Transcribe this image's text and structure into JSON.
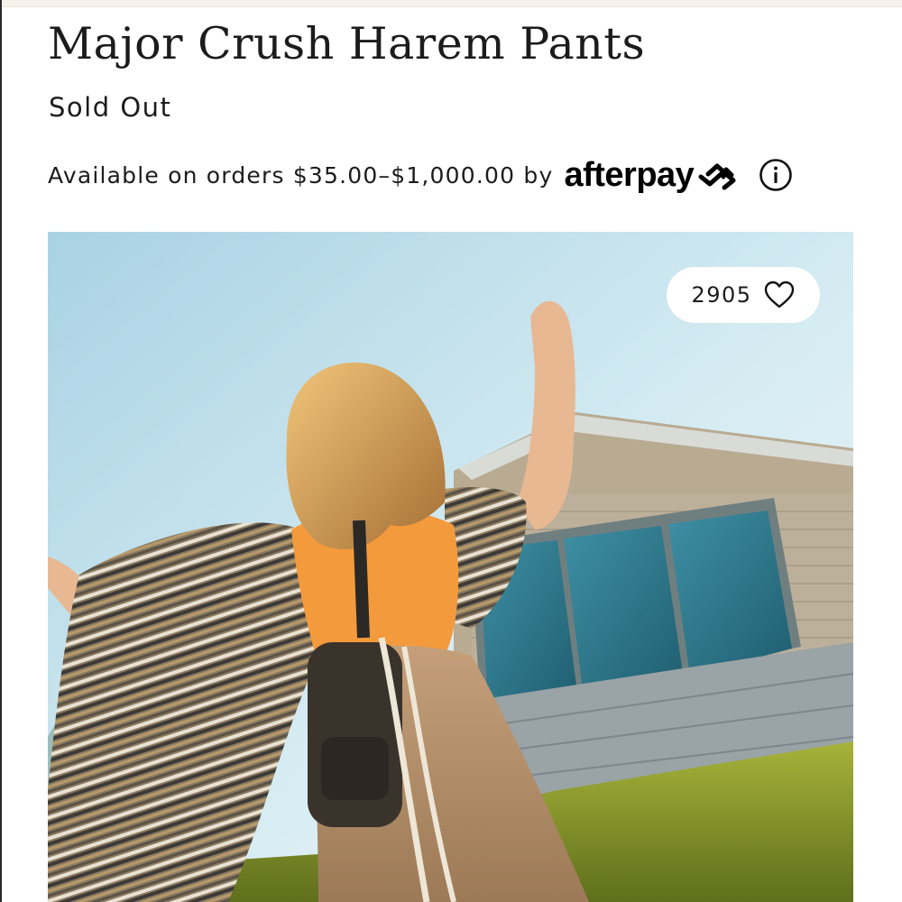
{
  "product": {
    "title": "Major Crush Harem Pants",
    "status": "Sold Out"
  },
  "afterpay": {
    "text": "Available on orders $35.00–$1,000.00 by",
    "logo_text": "afterpay",
    "logo_icon": "afterpay-arrows-icon",
    "info_icon": "info-circle-icon"
  },
  "hero_image": {
    "subject": "product-photo",
    "likes": {
      "count": "2905",
      "icon": "heart-outline-icon"
    }
  },
  "colors": {
    "accent_orange": "#f39a3d",
    "sky": "#b9dcec",
    "grass": "#8a9a2a"
  }
}
